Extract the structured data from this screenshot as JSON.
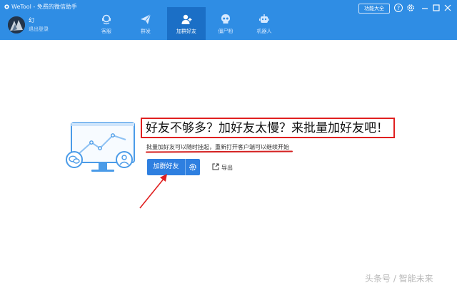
{
  "window": {
    "title": "WeTool - 免费的微信助手"
  },
  "user": {
    "name": "幻",
    "logout_label": "退出登录"
  },
  "tabs": [
    {
      "label": "客服",
      "icon": "headset-icon"
    },
    {
      "label": "群发",
      "icon": "send-icon"
    },
    {
      "label": "加群好友",
      "icon": "add-user-icon",
      "active": true
    },
    {
      "label": "僵尸粉",
      "icon": "skull-icon"
    },
    {
      "label": "机器人",
      "icon": "robot-icon"
    }
  ],
  "header": {
    "features_label": "功能大全"
  },
  "main": {
    "headline": "好友不够多？加好友太慢？来批量加好友吧！",
    "subtext": "批量加好友可以随时挂起，重新打开客户端可以继续开始",
    "add_button_label": "加群好友",
    "export_label": "导出"
  },
  "watermark": "头条号 / 智能未来",
  "colors": {
    "primary": "#2f8de4",
    "active_tab": "#1b6fc6",
    "button": "#2e7fe0",
    "annotation": "#e02020"
  }
}
